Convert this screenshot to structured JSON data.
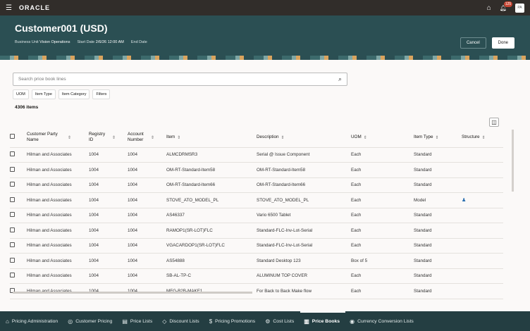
{
  "topbar": {
    "brand": "ORACLE",
    "notification_count": "125",
    "avatar": "PA"
  },
  "header": {
    "title": "Customer001 (USD)",
    "bu_label": "Business Unit",
    "bu_value": "Vision Operations",
    "start_label": "Start Date",
    "start_value": "2/6/26 12:00 AM",
    "end_label": "End Date",
    "cancel": "Cancel",
    "done": "Done"
  },
  "search": {
    "placeholder": "Search price book lines"
  },
  "chips": [
    "UOM",
    "Item Type",
    "Item Category",
    "Filters"
  ],
  "count": "4306 items",
  "columns": [
    "Customer Party Name",
    "Registry ID",
    "Account Number",
    "Item",
    "Description",
    "UOM",
    "Item Type",
    "Structure"
  ],
  "rows": [
    [
      "Hilman and Associates",
      "1004",
      "1004",
      "ALMCDRMSR3",
      "Serial @ Issue Component",
      "Each",
      "Standard",
      ""
    ],
    [
      "Hilman and Associates",
      "1004",
      "1004",
      "OM-RT-Standard-Item58",
      "OM-RT-Standard-Item58",
      "Each",
      "Standard",
      ""
    ],
    [
      "Hilman and Associates",
      "1004",
      "1004",
      "OM-RT-Standard-Item66",
      "OM-RT-Standard-Item66",
      "Each",
      "Standard",
      ""
    ],
    [
      "Hilman and Associates",
      "1004",
      "1004",
      "STOVE_ATO_MODEL_PL",
      "STOVE_ATO_MODEL_PL",
      "Each",
      "Model",
      "structure-icon"
    ],
    [
      "Hilman and Associates",
      "1004",
      "1004",
      "AS46337",
      "Vario 6500 Tablet",
      "Each",
      "Standard",
      ""
    ],
    [
      "Hilman and Associates",
      "1004",
      "1004",
      "RAMOP1(SR-LOT)FLC",
      "Standard-FLC-Inv-Lot-Serial",
      "Each",
      "Standard",
      ""
    ],
    [
      "Hilman and Associates",
      "1004",
      "1004",
      "VGACARDOP1(SR-LOT)FLC",
      "Standard-FLC-Inv-Lot-Serial",
      "Each",
      "Standard",
      ""
    ],
    [
      "Hilman and Associates",
      "1004",
      "1004",
      "AS54888",
      "Standard Desktop 123",
      "Box of 5",
      "Standard",
      ""
    ],
    [
      "Hilman and Associates",
      "1004",
      "1004",
      "SB-AL-TP-C",
      "ALUMINUM TOP COVER",
      "Each",
      "Standard",
      ""
    ],
    [
      "Hilman and Associates",
      "1004",
      "1004",
      "MFG-B2B-MAKE1",
      "For Back to Back Make flow",
      "Each",
      "Standard",
      ""
    ]
  ],
  "nav": [
    {
      "label": "Pricing Administration",
      "icon": "⌂"
    },
    {
      "label": "Customer Pricing",
      "icon": "◎"
    },
    {
      "label": "Price Lists",
      "icon": "▤"
    },
    {
      "label": "Discount Lists",
      "icon": "◇"
    },
    {
      "label": "Pricing Promotions",
      "icon": "$"
    },
    {
      "label": "Cost Lists",
      "icon": "⚙"
    },
    {
      "label": "Price Books",
      "icon": "▥",
      "active": true
    },
    {
      "label": "Currency Conversion Lists",
      "icon": "◉"
    }
  ]
}
